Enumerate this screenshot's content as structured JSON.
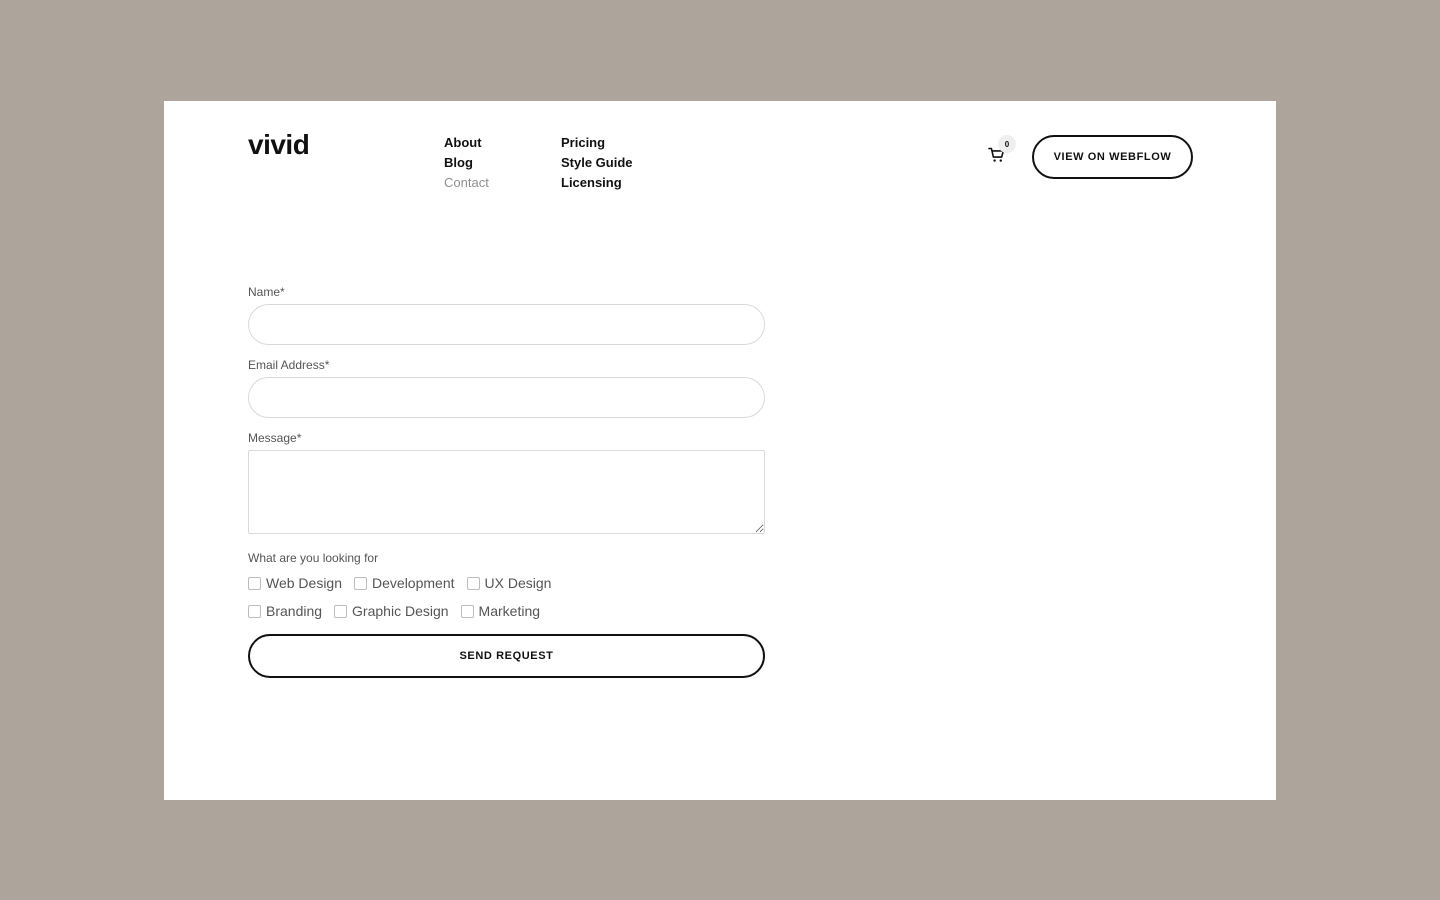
{
  "brand": {
    "logo": "vivid"
  },
  "nav": {
    "col1": [
      {
        "label": "About",
        "current": false
      },
      {
        "label": "Blog",
        "current": false
      },
      {
        "label": "Contact",
        "current": true
      }
    ],
    "col2": [
      {
        "label": "Pricing",
        "current": false
      },
      {
        "label": "Style Guide",
        "current": false
      },
      {
        "label": "Licensing",
        "current": false
      }
    ]
  },
  "cart": {
    "count": "0",
    "icon": "cart-icon"
  },
  "header": {
    "cta_label": "VIEW ON WEBFLOW"
  },
  "form": {
    "name_label": "Name*",
    "name_value": "",
    "email_label": "Email Address*",
    "email_value": "",
    "message_label": "Message*",
    "message_value": "",
    "looking_label": "What are you looking for",
    "options_row1": [
      "Web Design",
      "Development",
      "UX Design"
    ],
    "options_row2": [
      "Branding",
      "Graphic Design",
      "Marketing"
    ],
    "submit_label": "SEND REQUEST"
  },
  "colors": {
    "backdrop": "#ada59b",
    "surface": "#ffffff",
    "text": "#111111",
    "muted": "#8f8f8f"
  }
}
